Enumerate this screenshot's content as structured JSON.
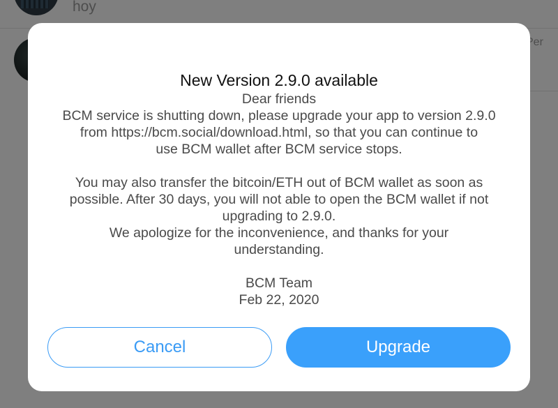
{
  "background": {
    "chat_preview": "hoy",
    "chat_time": "Per"
  },
  "dialog": {
    "title": "New Version 2.9.0 available",
    "body_lines": [
      "Dear friends",
      "BCM service is shutting down, please upgrade your app to version 2.9.0",
      "from https://bcm.social/download.html, so that you can continue to",
      "use BCM wallet after BCM service stops.",
      "",
      "You may also transfer the bitcoin/ETH out of BCM wallet as soon as",
      "possible. After 30 days, you will not able to open the BCM wallet if not",
      "upgrading to 2.9.0.",
      "We apologize for the inconvenience, and thanks for your",
      "understanding.",
      "",
      "BCM Team",
      "Feb 22, 2020"
    ],
    "cancel_label": "Cancel",
    "upgrade_label": "Upgrade"
  },
  "colors": {
    "accent": "#3aa0fb",
    "overlay": "rgba(0,0,0,0.5)",
    "dialog_background": "#ffffff"
  }
}
